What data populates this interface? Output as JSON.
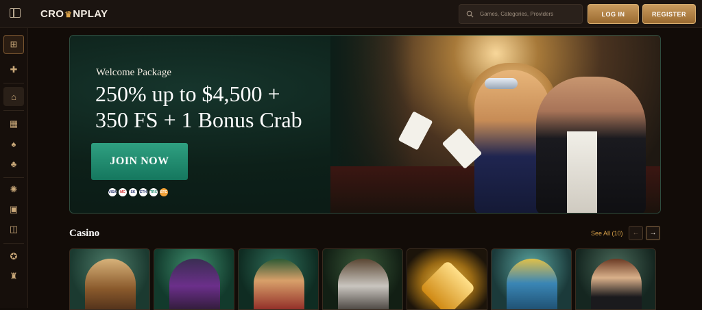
{
  "header": {
    "logo_text_left": "CRO",
    "logo_crown": "♛",
    "logo_text_right": "NPLAY",
    "search_placeholder": "Games, Categories, Providers",
    "login_label": "LOG IN",
    "register_label": "REGISTER"
  },
  "sidebar": {
    "items": [
      {
        "icon": "gift-box-icon",
        "glyph": "⊞"
      },
      {
        "icon": "gift-icon",
        "glyph": "✚"
      },
      {
        "icon": "home-icon",
        "glyph": "⌂"
      },
      {
        "icon": "slots-icon",
        "glyph": "▦"
      },
      {
        "icon": "spade-icon",
        "glyph": "♠"
      },
      {
        "icon": "clover-icon",
        "glyph": "♣"
      },
      {
        "icon": "roulette-icon",
        "glyph": "✺"
      },
      {
        "icon": "live-casino-icon",
        "glyph": "▣"
      },
      {
        "icon": "gamepad-icon",
        "glyph": "◫"
      },
      {
        "icon": "medal-icon",
        "glyph": "✪"
      },
      {
        "icon": "trophy-icon",
        "glyph": "♜"
      }
    ]
  },
  "hero": {
    "subtitle": "Welcome Package",
    "title_line1": "250% up to $4,500 +",
    "title_line2": "350 FS + 1 Bonus Crab",
    "cta_label": "JOIN NOW",
    "payments": [
      "VISA",
      "MC",
      "SK",
      "ETH",
      "TRX",
      "BTC"
    ]
  },
  "casino": {
    "title": "Casino",
    "see_all_label": "See All (10)",
    "prev_label": "←",
    "next_label": "→"
  },
  "colors": {
    "accent_gold": "#d9a24a",
    "cta_green": "#1f8c6f",
    "background": "#120c08"
  }
}
